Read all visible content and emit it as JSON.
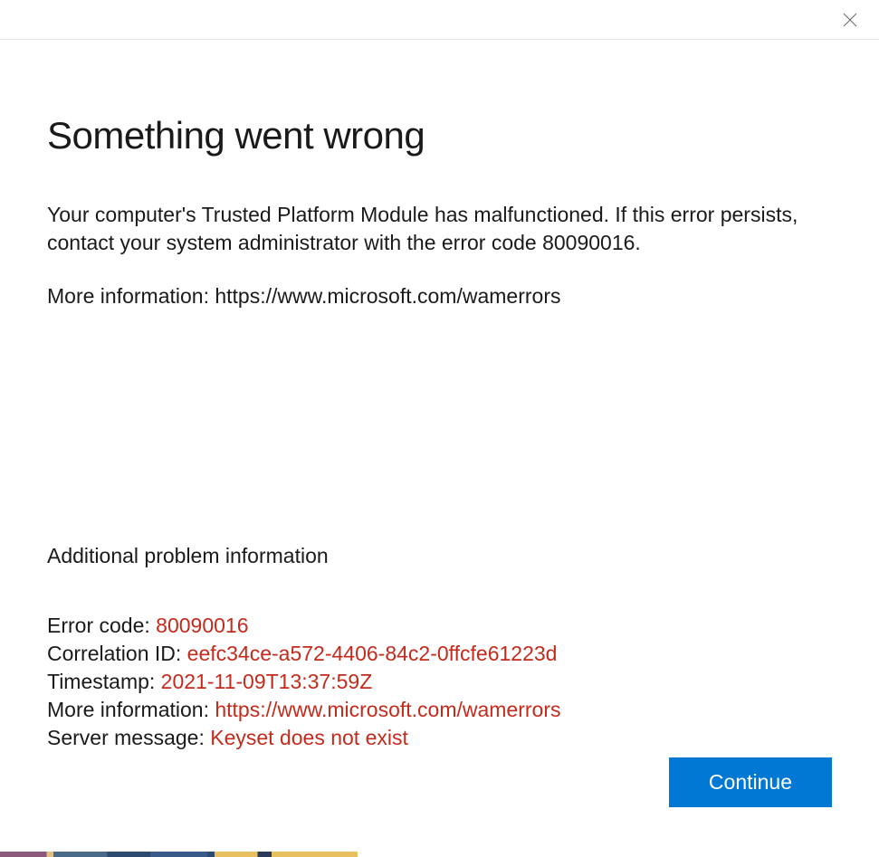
{
  "heading": "Something went wrong",
  "body_text": "Your computer's Trusted Platform Module has malfunctioned. If this error persists, contact your system administrator with the error code 80090016.",
  "more_info_line": "More information: https://www.microsoft.com/wamerrors",
  "additional_heading": "Additional problem information",
  "details": {
    "error_code_label": "Error code: ",
    "error_code_value": "80090016",
    "correlation_label": "Correlation ID: ",
    "correlation_value": "eefc34ce-a572-4406-84c2-0ffcfe61223d",
    "timestamp_label": "Timestamp: ",
    "timestamp_value": "2021-11-09T13:37:59Z",
    "more_info_label": "More information: ",
    "more_info_value": "https://www.microsoft.com/wamerrors",
    "server_msg_label": "Server message: ",
    "server_msg_value": "Keyset does not exist"
  },
  "continue_button": "Continue",
  "colors": {
    "error_red": "#c42b1c",
    "primary_blue": "#0078d4"
  }
}
